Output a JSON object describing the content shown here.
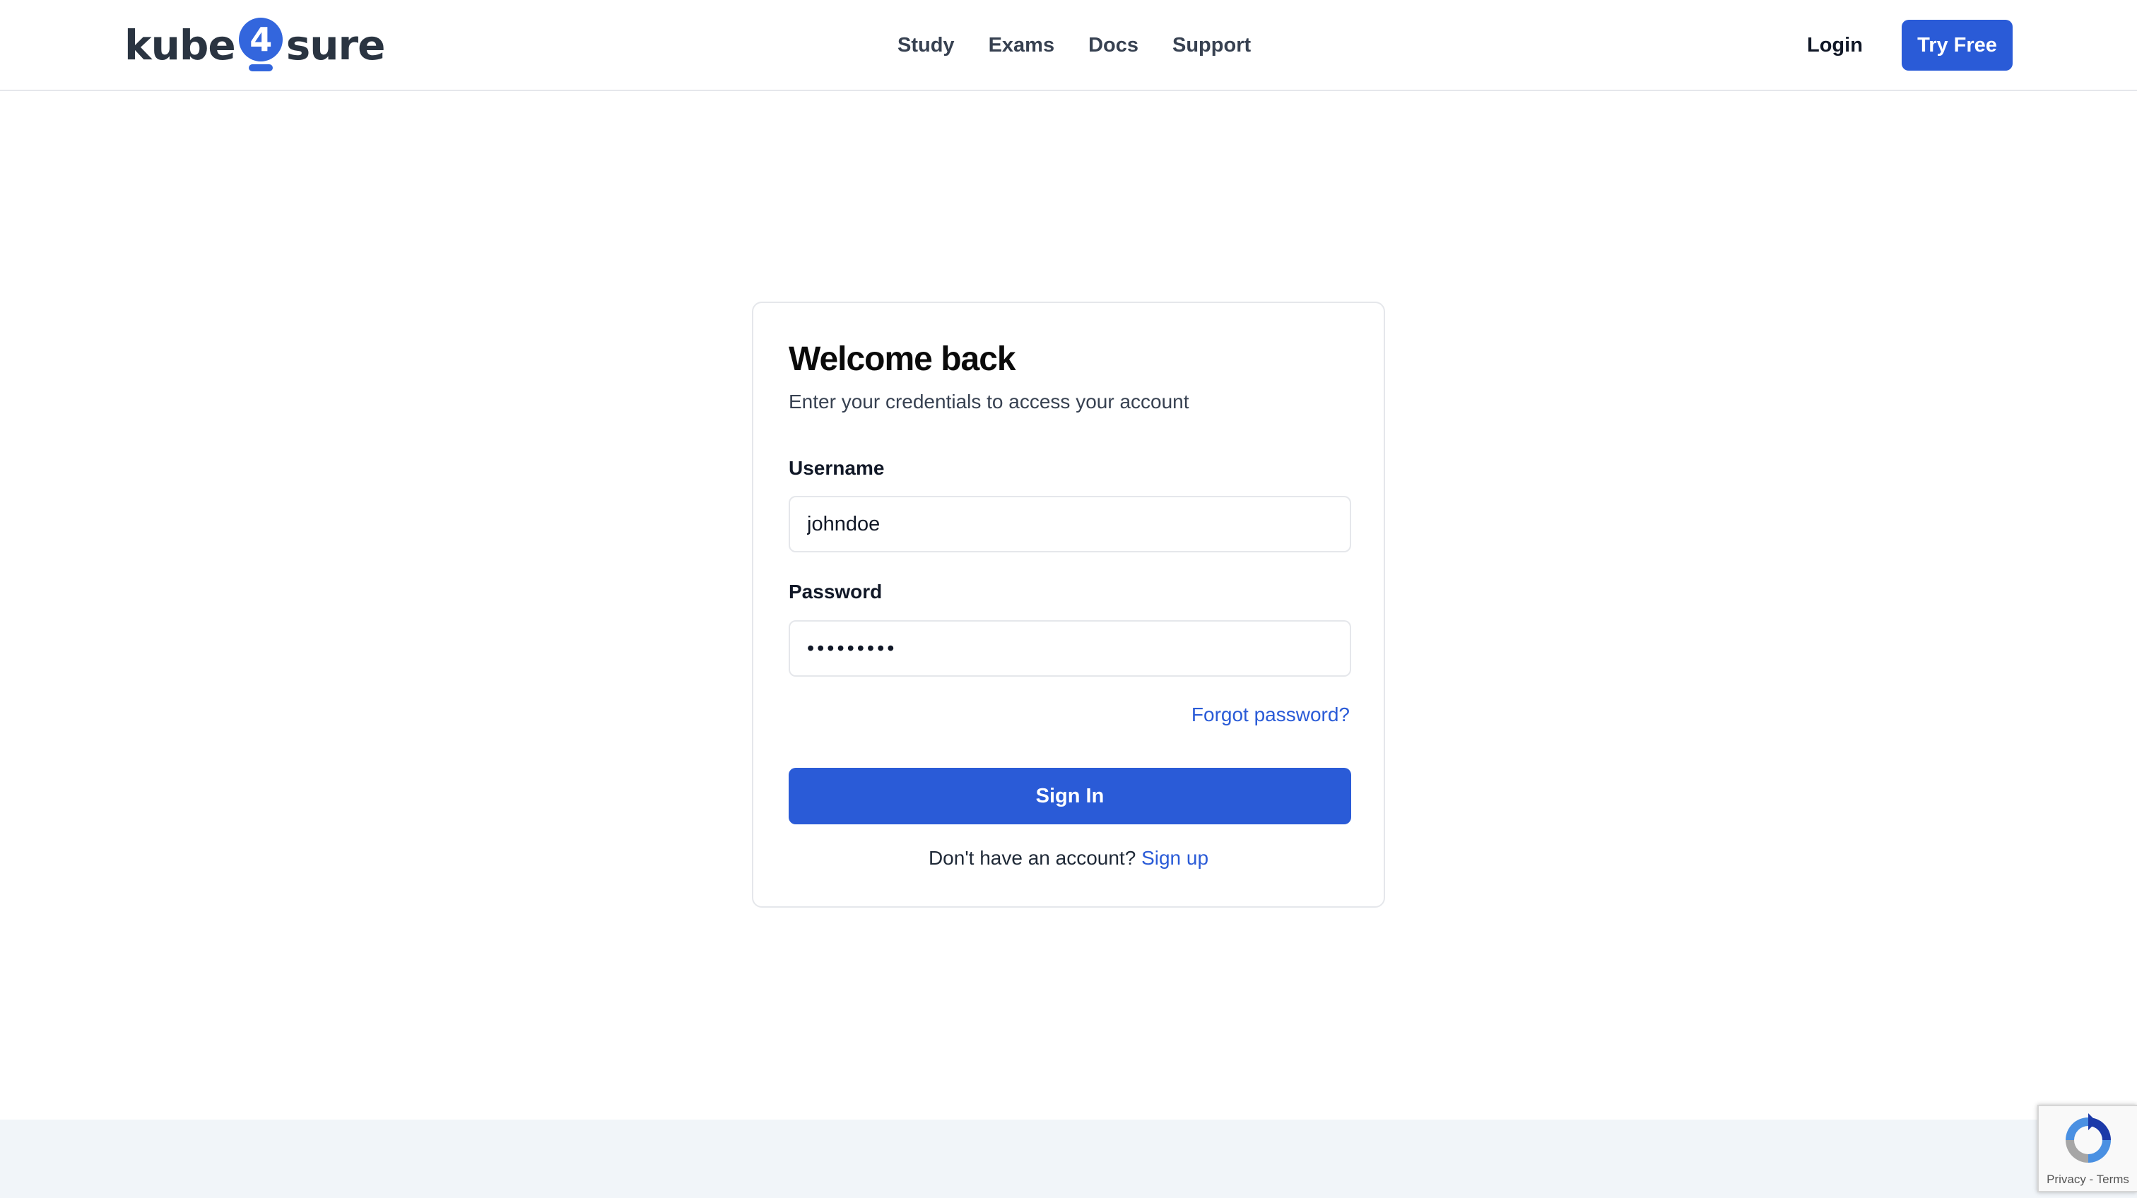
{
  "header": {
    "logo": {
      "left": "kube",
      "badge": "4",
      "right": "sure"
    },
    "nav": [
      {
        "label": "Study"
      },
      {
        "label": "Exams"
      },
      {
        "label": "Docs"
      },
      {
        "label": "Support"
      }
    ],
    "login_label": "Login",
    "try_free_label": "Try Free"
  },
  "login_card": {
    "title": "Welcome back",
    "subtitle": "Enter your credentials to access your account",
    "username": {
      "label": "Username",
      "value": "johndoe"
    },
    "password": {
      "label": "Password",
      "value": "•••••••••"
    },
    "forgot_label": "Forgot password?",
    "submit_label": "Sign In",
    "signup_prompt": "Don't have an account?",
    "signup_label": "Sign up"
  },
  "recaptcha": {
    "text": "Privacy - Terms"
  },
  "colors": {
    "accent": "#2a5bd7",
    "logo_badge": "#3366dd",
    "footer_bg": "#f1f5f9"
  }
}
